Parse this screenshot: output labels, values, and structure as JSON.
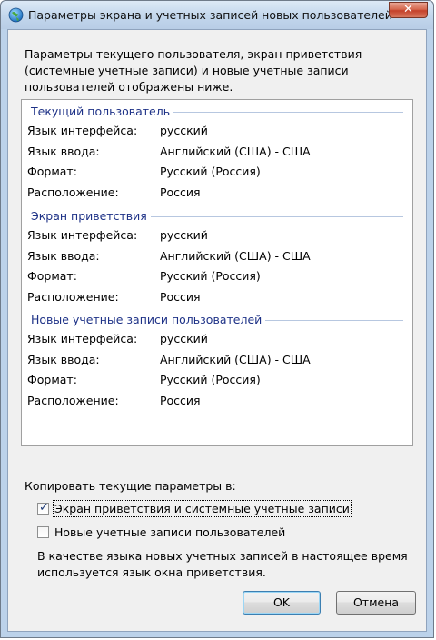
{
  "window": {
    "title": "Параметры экрана и учетных записей новых пользователей",
    "close_glyph": "✕"
  },
  "intro": "Параметры текущего пользователя, экран приветствия (системные учетные записи) и новые учетные записи пользователей отображены ниже.",
  "sections": [
    {
      "title": "Текущий пользователь",
      "rows": [
        {
          "label": "Язык интерфейса:",
          "value": "русский"
        },
        {
          "label": "Язык ввода:",
          "value": "Английский (США) - США"
        },
        {
          "label": "Формат:",
          "value": "Русский (Россия)"
        },
        {
          "label": "Расположение:",
          "value": "Россия"
        }
      ]
    },
    {
      "title": "Экран приветствия",
      "rows": [
        {
          "label": "Язык интерфейса:",
          "value": "русский"
        },
        {
          "label": "Язык ввода:",
          "value": "Английский (США) - США"
        },
        {
          "label": "Формат:",
          "value": "Русский (Россия)"
        },
        {
          "label": "Расположение:",
          "value": "Россия"
        }
      ]
    },
    {
      "title": "Новые учетные записи пользователей",
      "rows": [
        {
          "label": "Язык интерфейса:",
          "value": "русский"
        },
        {
          "label": "Язык ввода:",
          "value": "Английский (США) - США"
        },
        {
          "label": "Формат:",
          "value": "Русский (Россия)"
        },
        {
          "label": "Расположение:",
          "value": "Россия"
        }
      ]
    }
  ],
  "copy": {
    "label": "Копировать текущие параметры в:",
    "welcome_checkbox": {
      "label": "Экран приветствия и системные учетные записи",
      "checked": true
    },
    "new_users_checkbox": {
      "label": "Новые учетные записи пользователей",
      "checked": false
    },
    "check_glyph": "✓"
  },
  "note": "В качестве языка новых учетных записей в настоящее время используется язык окна приветствия.",
  "buttons": {
    "ok": "OK",
    "cancel": "Отмена"
  }
}
